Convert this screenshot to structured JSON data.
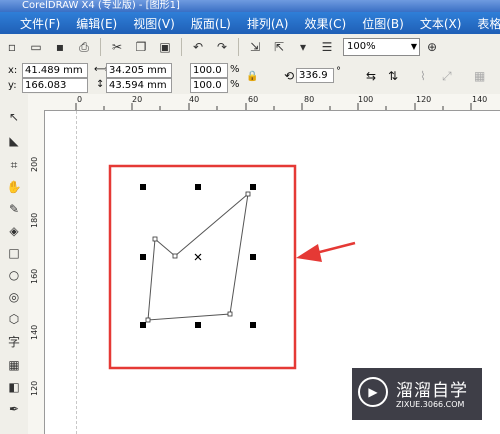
{
  "window": {
    "title": "CorelDRAW X4 (专业版) - [图形1]"
  },
  "menu": [
    "文件(F)",
    "编辑(E)",
    "视图(V)",
    "版面(L)",
    "排列(A)",
    "效果(C)",
    "位图(B)",
    "文本(X)",
    "表格(T)"
  ],
  "toolbar": {
    "zoom": "100%"
  },
  "property_bar": {
    "x_label": "x:",
    "x_value": "41.489 mm",
    "y_label": "y:",
    "y_value": "166.083 mm",
    "width_value": "34.205 mm",
    "height_value": "43.594 mm",
    "scale_x": "100.0",
    "scale_y": "100.0",
    "percent": "%",
    "rotation": "336.9",
    "degree": "°"
  },
  "rulers": {
    "horizontal": [
      "0",
      "20",
      "40",
      "60",
      "80",
      "100",
      "120",
      "140"
    ],
    "vertical": [
      "200",
      "180",
      "160",
      "140",
      "120"
    ]
  },
  "tools": {
    "text_tool": "字"
  },
  "watermark": {
    "name": "溜溜自学",
    "url": "ZIXUE.3066.COM"
  },
  "colors": {
    "selection_highlight": "#e53935",
    "menubar": "#2f7fd8"
  }
}
